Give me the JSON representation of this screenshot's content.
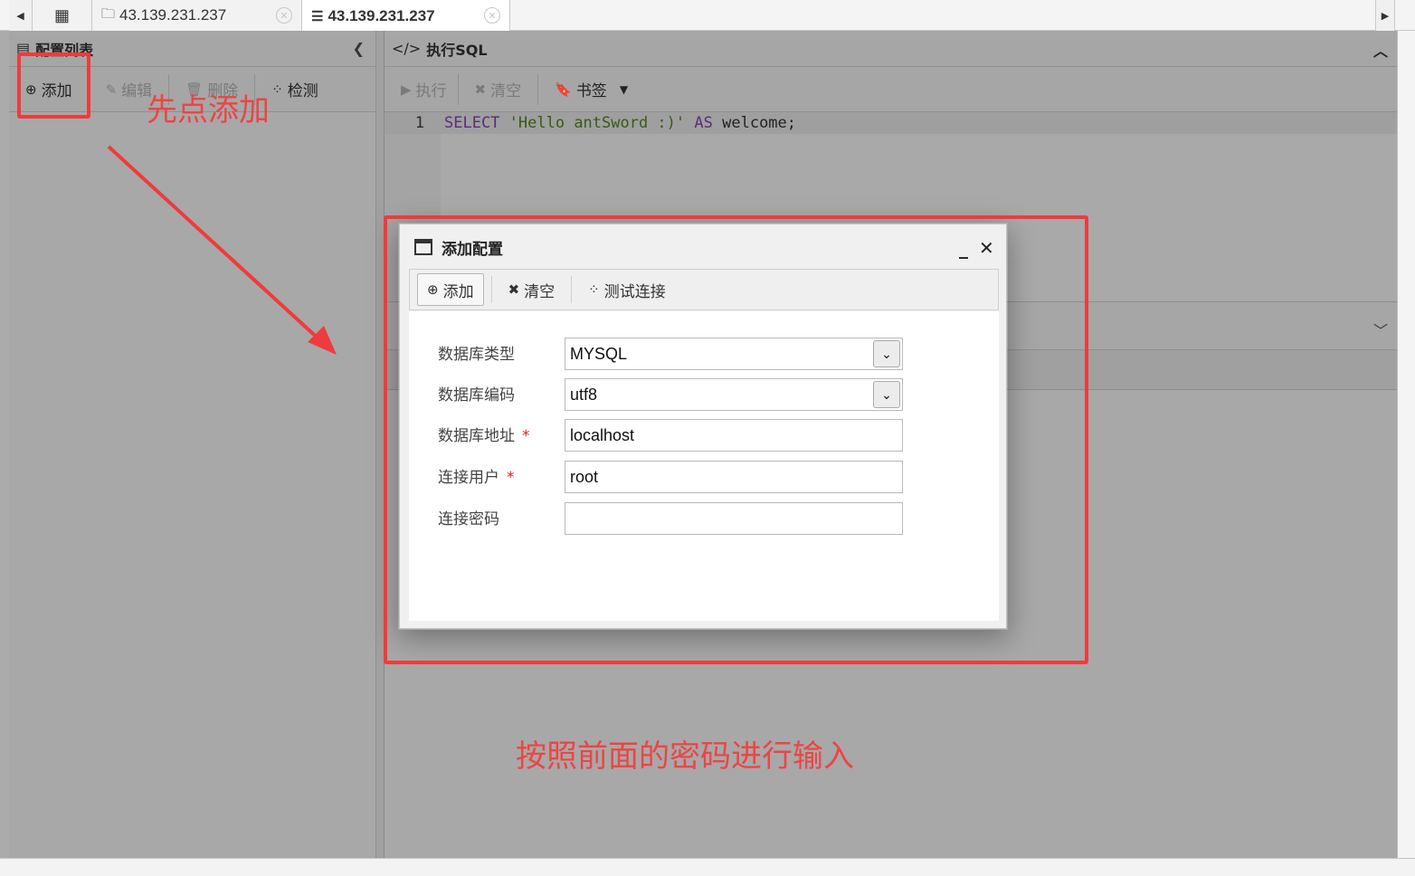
{
  "tabs": [
    {
      "label": "",
      "icon": "grid-icon"
    },
    {
      "label": "43.139.231.237",
      "icon": "folder-icon"
    },
    {
      "label": "43.139.231.237",
      "icon": "database-icon",
      "active": true
    }
  ],
  "left_panel": {
    "title": "配置列表",
    "toolbar": {
      "add": "添加",
      "edit": "编辑",
      "delete": "删除",
      "check": "检测"
    }
  },
  "sql_panel": {
    "title": "执行SQL",
    "toolbar": {
      "run": "执行",
      "clear": "清空",
      "bookmark": "书签"
    },
    "editor": {
      "line_number": "1",
      "kw_select": "SELECT",
      "string": "'Hello antSword :)'",
      "kw_as": "AS",
      "rest": "welcome;"
    }
  },
  "modal": {
    "title": "添加配置",
    "toolbar": {
      "add": "添加",
      "clear": "清空",
      "test": "测试连接"
    },
    "fields": {
      "db_type": {
        "label": "数据库类型",
        "value": "MYSQL"
      },
      "db_encoding": {
        "label": "数据库编码",
        "value": "utf8"
      },
      "db_host": {
        "label": "数据库地址",
        "value": "localhost",
        "required": "*"
      },
      "db_user": {
        "label": "连接用户",
        "value": "root",
        "required": "*"
      },
      "db_password": {
        "label": "连接密码",
        "value": ""
      }
    }
  },
  "annotations": {
    "step1": "先点添加",
    "step2": "按照前面的密码进行输入"
  },
  "colors": {
    "annotation_red": "#ef3b3b",
    "keyword": "#5a2c7a",
    "string": "#3b5a12"
  }
}
